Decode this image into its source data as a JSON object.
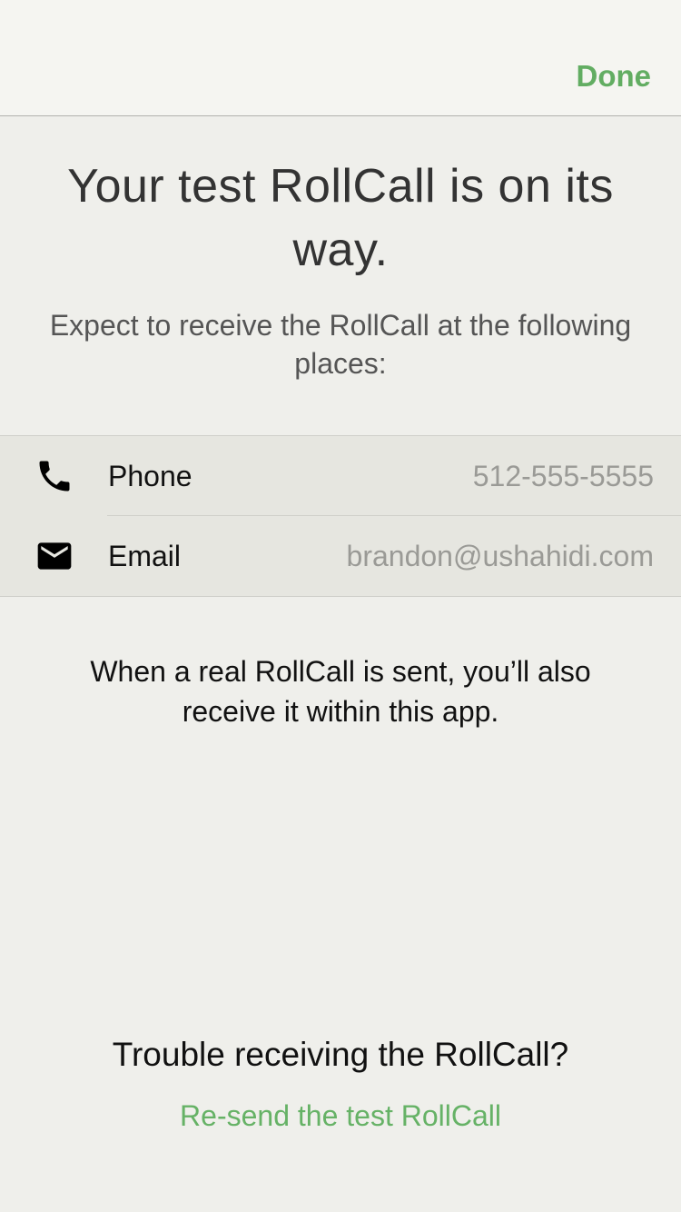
{
  "nav": {
    "done_label": "Done"
  },
  "header": {
    "title": "Your test RollCall is on its way.",
    "subtitle": "Expect to receive the RollCall at the following places:"
  },
  "contacts": [
    {
      "icon": "phone-icon",
      "label": "Phone",
      "value": "512-555-5555"
    },
    {
      "icon": "email-icon",
      "label": "Email",
      "value": "brandon@ushahidi.com"
    }
  ],
  "info": {
    "text": "When a real RollCall is sent, you’ll also receive it within this app."
  },
  "footer": {
    "trouble_text": "Trouble receiving the RollCall?",
    "resend_label": "Re-send the test RollCall"
  },
  "colors": {
    "accent": "#62ad62",
    "background": "#efefeb",
    "nav_background": "#f5f5f1",
    "list_background": "#e6e6e0",
    "secondary_text": "#9a9a96"
  }
}
